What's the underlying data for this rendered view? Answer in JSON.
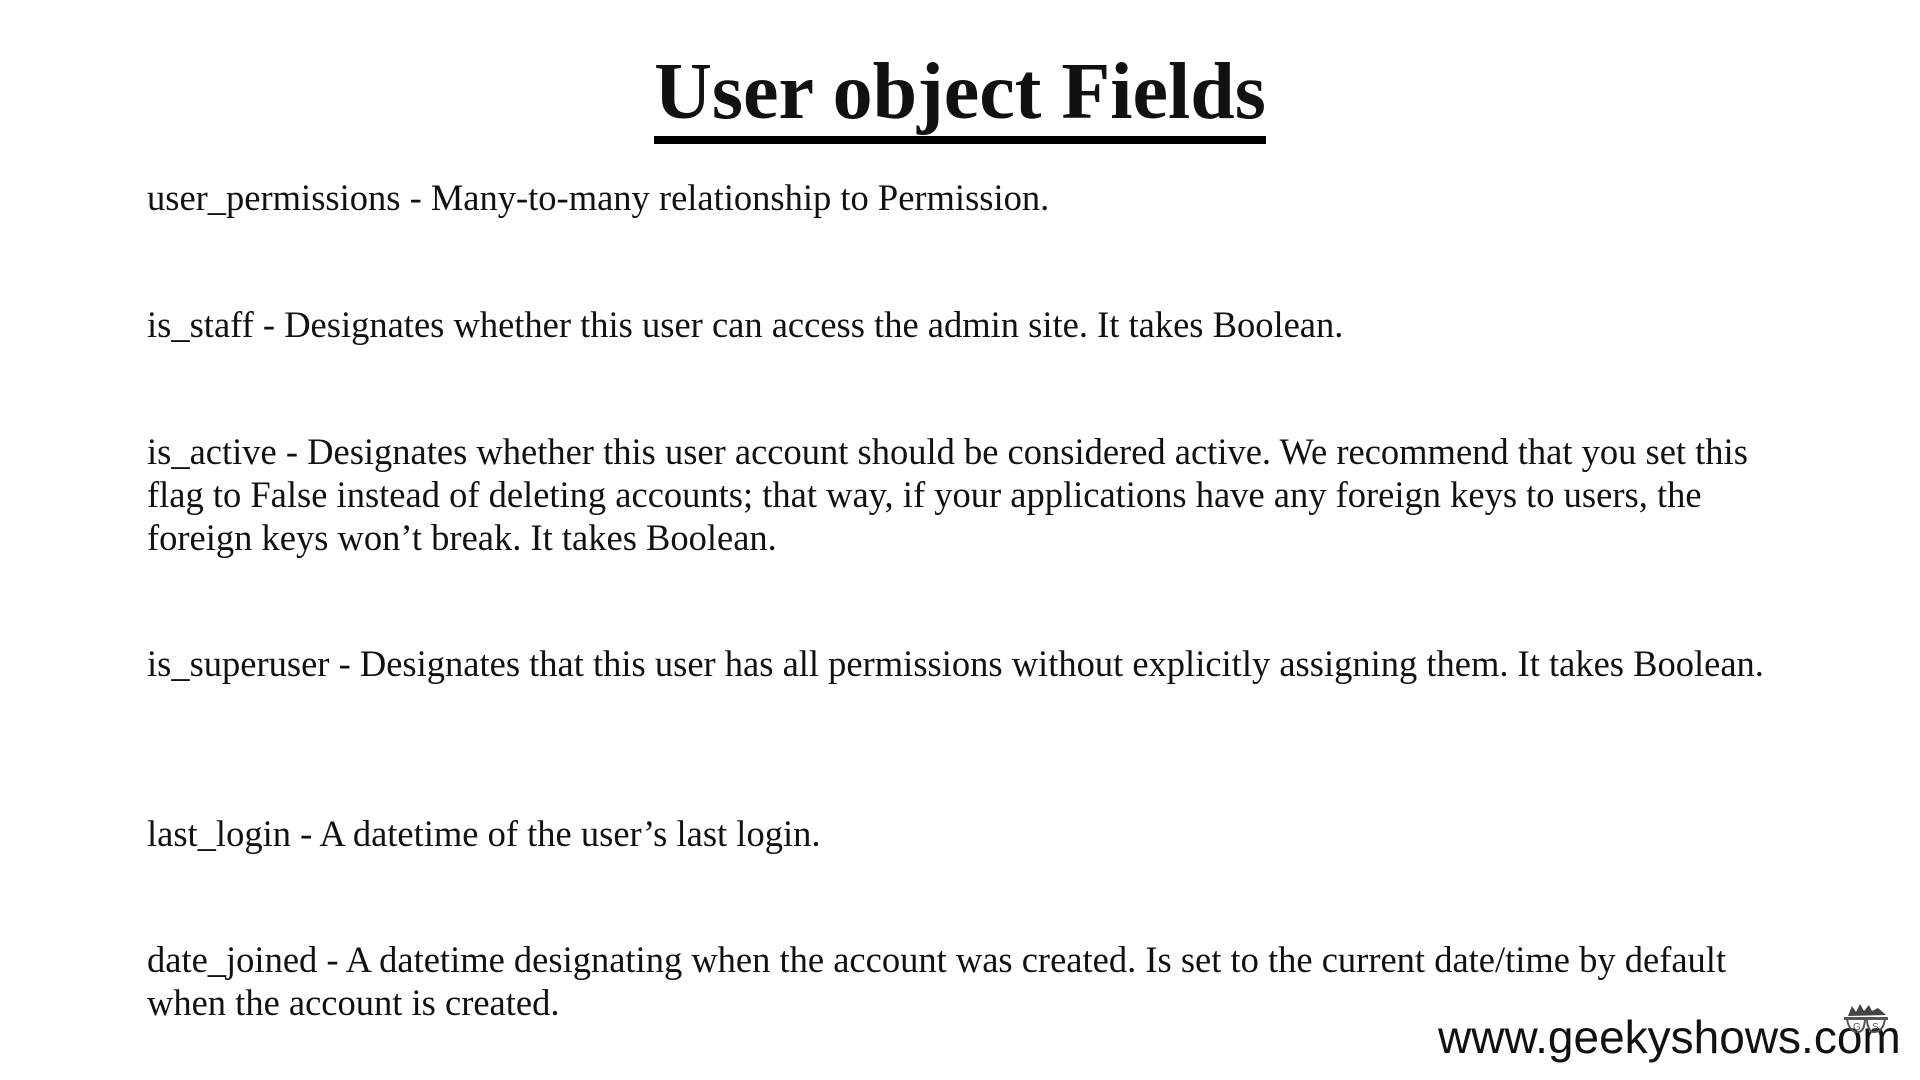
{
  "title": "User object Fields",
  "fields": [
    {
      "text": "user_permissions - Many-to-many relationship to Permission."
    },
    {
      "text": "is_staff - Designates whether this user can access the admin site. It takes Boolean."
    },
    {
      "text": "is_active - Designates whether this user account should be considered active. We recommend that you set this flag to False instead of deleting accounts; that way, if your applications have any foreign keys to users, the foreign keys won’t break. It takes Boolean."
    },
    {
      "text": "is_superuser - Designates that this user has all permissions without explicitly assigning them. It takes Boolean."
    },
    {
      "text": "last_login - A datetime of the user’s last login."
    },
    {
      "text": "date_joined - A datetime designating when the account was created. Is set to the current date/time by default when the account is created."
    }
  ],
  "watermark": {
    "text": "www.geekyshows.com",
    "logo_letters": "GS"
  }
}
